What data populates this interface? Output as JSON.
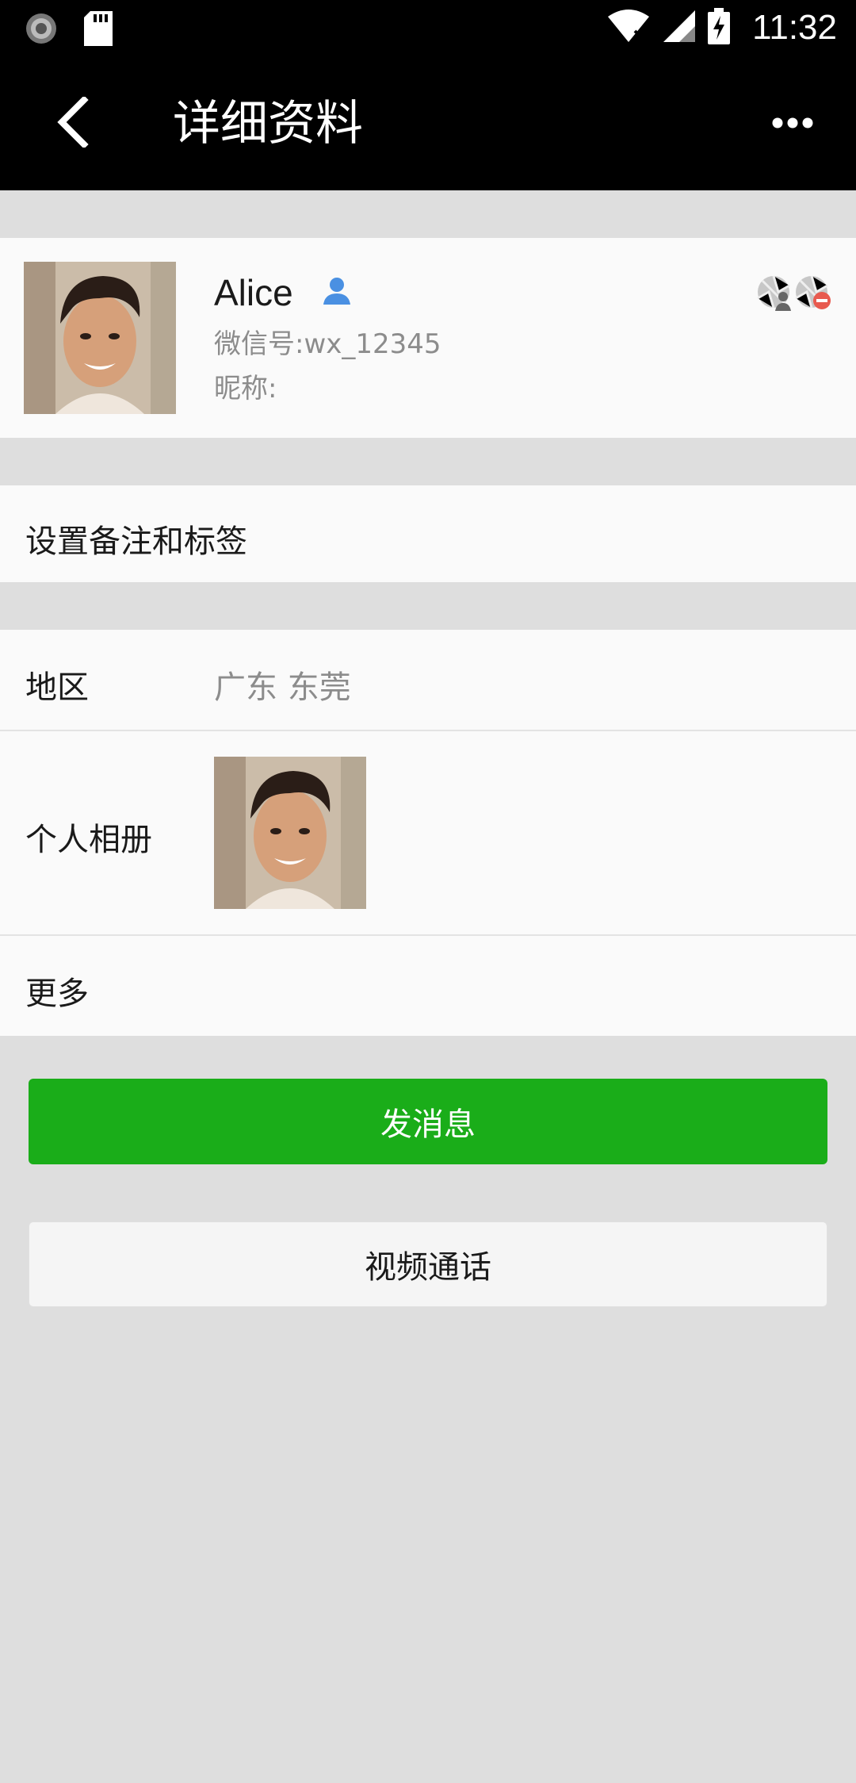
{
  "status_bar": {
    "time": "11:32"
  },
  "app_bar": {
    "title": "详细资料"
  },
  "profile": {
    "name": "Alice",
    "wechat_id": "微信号:wx_12345",
    "nickname": "昵称:"
  },
  "settings": {
    "remark_tags_label": "设置备注和标签"
  },
  "info": {
    "region_label": "地区",
    "region_value": "广东 东莞",
    "album_label": "个人相册",
    "more_label": "更多"
  },
  "actions": {
    "send_message": "发消息",
    "video_call": "视频通话"
  },
  "colors": {
    "primary_green": "#1aad19",
    "background": "#dedede",
    "bar_black": "#000000"
  }
}
